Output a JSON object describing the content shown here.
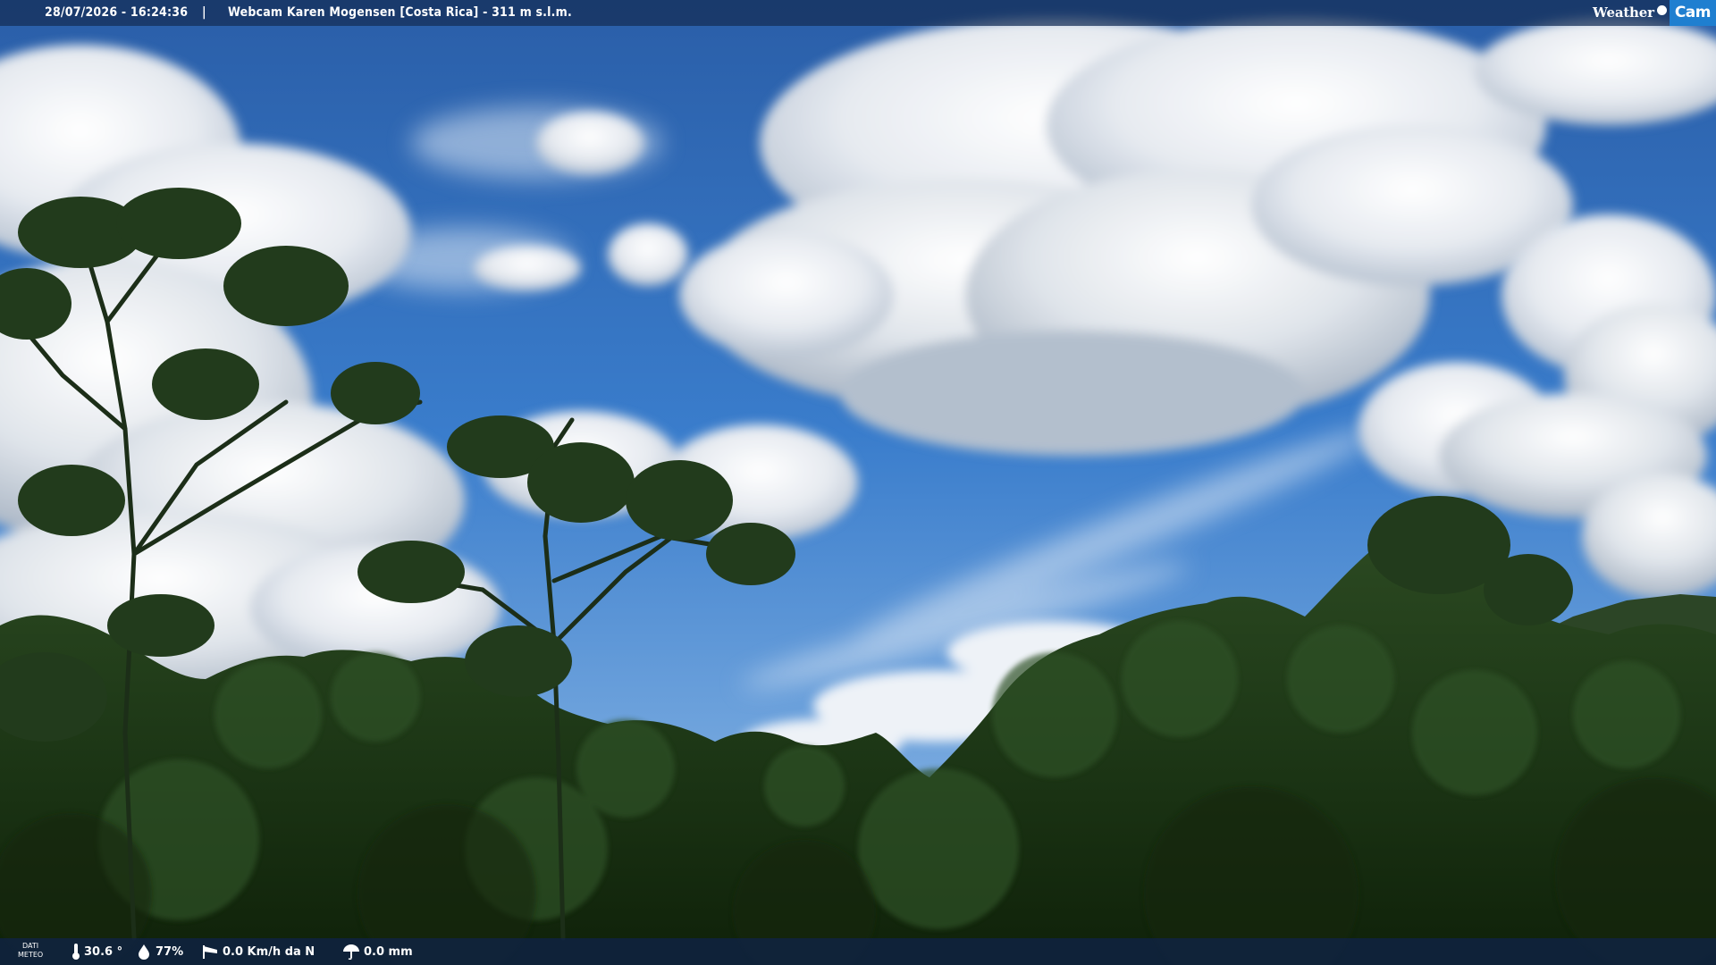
{
  "overlay_top": {
    "timestamp": "28/07/2026 - 16:24:36",
    "separator": "|",
    "title": "Webcam Karen Mogensen [Costa Rica] - 311 m s.l.m.",
    "logo_weather": "Weather",
    "logo_cam": "Cam"
  },
  "overlay_bottom": {
    "label_line1": "DATI",
    "label_line2": "METEO",
    "temperature": "30.6 °",
    "temperature_icon": "thermometer-icon",
    "humidity": "77%",
    "humidity_icon": "droplet-icon",
    "wind": "0.0 Km/h da N",
    "wind_icon": "wind-sock-icon",
    "rain": "0.0 mm",
    "rain_icon": "umbrella-icon"
  },
  "scene": {
    "sky_color": "#2f6cbf",
    "cloud_color": "#f2f4f7",
    "forest_color": "#1a3414"
  }
}
